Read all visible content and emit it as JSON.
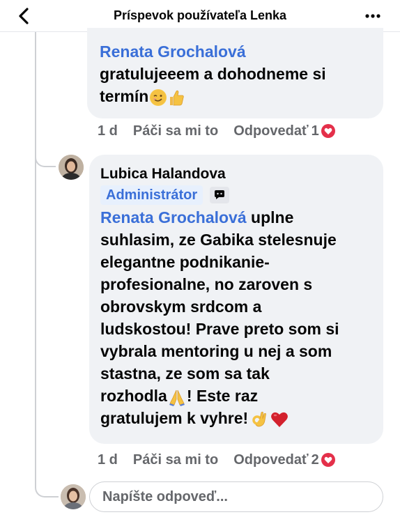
{
  "header": {
    "title": "Príspevok používateľa Lenka"
  },
  "comment1": {
    "mention": "Renata Grochalová",
    "line1": "gratulujeeem a dohodneme si",
    "line2": "termín",
    "time": "1 d",
    "like_label": "Páči sa mi to",
    "reply_label": "Odpovedať",
    "reaction_count": "1"
  },
  "comment2": {
    "author": "Lubica Halandova",
    "badge": "Administrátor",
    "mention": "Renata Grochalová",
    "lines": [
      "uplne",
      "suhlasim, ze Gabika stelesnuje",
      "elegantne podnikanie-",
      "profesionalne, no zaroven s",
      "obrovskym srdcom a",
      "ludskostou! Prave preto som si",
      "vybrala mentoring u nej a som",
      "stastna, ze som sa tak",
      "rozhodla",
      "! Este raz",
      "gratulujem k vyhre!"
    ],
    "time": "1 d",
    "like_label": "Páči sa mi to",
    "reply_label": "Odpovedať",
    "reaction_count": "2"
  },
  "reply_box": {
    "placeholder": "Napíšte odpoveď..."
  },
  "colors": {
    "mention": "#3a6fd8",
    "bubble": "#f0f2f5",
    "heart_reaction": "#e4304a",
    "secondary_text": "#65676b"
  },
  "icons": {
    "back": "chevron-left-icon",
    "more": "more-dots-icon",
    "badge_extra": "speech-bubble-icon",
    "reaction": "heart-reaction-icon"
  }
}
